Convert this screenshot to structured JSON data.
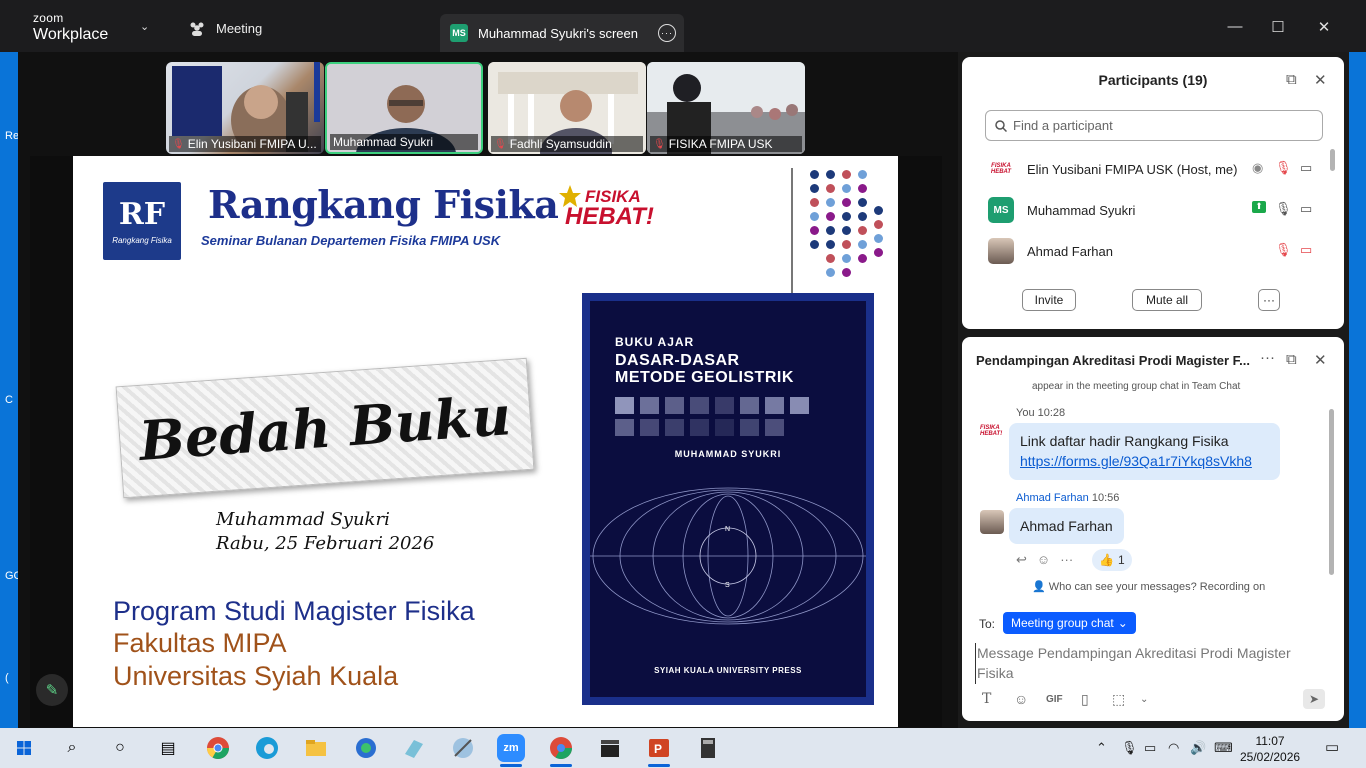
{
  "app": {
    "brand_top": "zoom",
    "brand_bottom": "Workplace",
    "meeting_tab": "Meeting",
    "screen_tab": "Muhammad Syukri's screen",
    "screen_tab_badge": "MS"
  },
  "left_edge": [
    "Re",
    "C",
    "GC",
    "("
  ],
  "thumbnails": [
    {
      "name": "Elin Yusibani FMIPA U...",
      "muted": true
    },
    {
      "name": "Muhammad Syukri",
      "muted": false
    },
    {
      "name": "Fadhli Syamsuddin",
      "muted": true
    },
    {
      "name": "FISIKA FMIPA USK",
      "muted": true
    }
  ],
  "slide": {
    "logo_text": "RF",
    "logo_sub": "Rangkang Fisika",
    "title": "Rangkang Fisika",
    "subtitle": "Seminar Bulanan Departemen Fisika FMIPA USK",
    "badge_top": "FISIKA",
    "badge_bottom": "HEBAT!",
    "banner": "Bedah Buku",
    "author": "Muhammad Syukri",
    "date": "Rabu, 25 Februari 2026",
    "program": "Program Studi Magister Fisika",
    "faculty": "Fakultas MIPA",
    "university": "Universitas Syiah Kuala",
    "book": {
      "kicker": "BUKU AJAR",
      "title_1": "DASAR-DASAR",
      "title_2": "METODE GEOLISTRIK",
      "author": "MUHAMMAD SYUKRI",
      "n_label": "N",
      "s_label": "S",
      "press": "SYIAH KUALA UNIVERSITY PRESS"
    }
  },
  "participants": {
    "title": "Participants (19)",
    "search_placeholder": "Find a participant",
    "rows": [
      {
        "name": "Elin Yusibani FMIPA USK (Host, me)",
        "avatar": "FISIKA HEBAT"
      },
      {
        "name": "Muhammad Syukri",
        "avatar": "MS"
      },
      {
        "name": "Ahmad Farhan",
        "avatar": ""
      }
    ],
    "invite": "Invite",
    "mute_all": "Mute all",
    "more": "···"
  },
  "chat": {
    "title": "Pendampingan Akreditasi Prodi Magister F...",
    "notice": "appear in the meeting group chat in Team Chat",
    "messages": [
      {
        "sender": "You",
        "time": "10:28",
        "text": "Link daftar hadir  Rangkang Fisika",
        "link": "https://forms.gle/93Qa1r7iYkq8sVkh8"
      },
      {
        "sender": "Ahmad Farhan",
        "time": "10:56",
        "text": "Ahmad Farhan",
        "reaction": "👍",
        "reaction_count": "1"
      }
    ],
    "privacy": "Who can see your messages? Recording on",
    "to_label": "To:",
    "recipient": "Meeting group chat",
    "compose_placeholder": "Message Pendampingan Akreditasi Prodi Magister Fisika",
    "gif": "GIF"
  },
  "taskbar": {
    "time": "11:07",
    "date": "25/02/2026",
    "zoom_label": "zm"
  },
  "colors": {
    "accent": "#0b5cff",
    "slide_blue": "#1d2f8a",
    "slide_brown": "#a0521a",
    "book_navy": "#0b0d3f",
    "ms_green": "#1e9e70",
    "windows_blue": "#0a74d8"
  }
}
